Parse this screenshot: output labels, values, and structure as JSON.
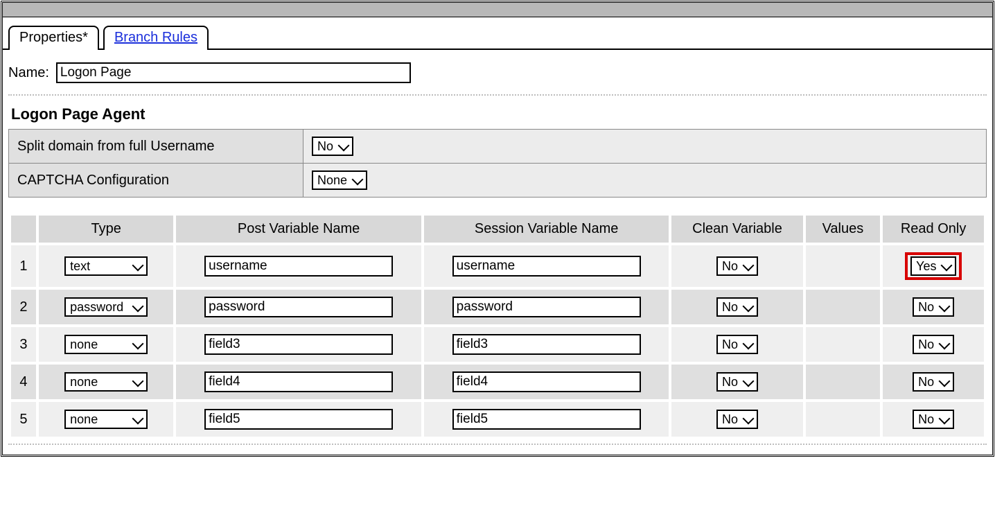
{
  "tabs": {
    "properties": "Properties*",
    "branch_rules": "Branch Rules"
  },
  "name_label": "Name:",
  "name_value": "Logon Page",
  "section_title": "Logon Page Agent",
  "settings": {
    "split_domain_label": "Split domain from full Username",
    "split_domain_value": "No",
    "captcha_label": "CAPTCHA Configuration",
    "captcha_value": "None"
  },
  "grid": {
    "headers": {
      "type": "Type",
      "post": "Post Variable Name",
      "session": "Session Variable Name",
      "clean": "Clean Variable",
      "values": "Values",
      "readonly": "Read Only"
    },
    "rows": [
      {
        "num": "1",
        "type": "text",
        "post": "username",
        "session": "username",
        "clean": "No",
        "values": "",
        "readonly": "Yes",
        "highlight_ro": true
      },
      {
        "num": "2",
        "type": "password",
        "post": "password",
        "session": "password",
        "clean": "No",
        "values": "",
        "readonly": "No",
        "highlight_ro": false
      },
      {
        "num": "3",
        "type": "none",
        "post": "field3",
        "session": "field3",
        "clean": "No",
        "values": "",
        "readonly": "No",
        "highlight_ro": false
      },
      {
        "num": "4",
        "type": "none",
        "post": "field4",
        "session": "field4",
        "clean": "No",
        "values": "",
        "readonly": "No",
        "highlight_ro": false
      },
      {
        "num": "5",
        "type": "none",
        "post": "field5",
        "session": "field5",
        "clean": "No",
        "values": "",
        "readonly": "No",
        "highlight_ro": false
      }
    ]
  }
}
